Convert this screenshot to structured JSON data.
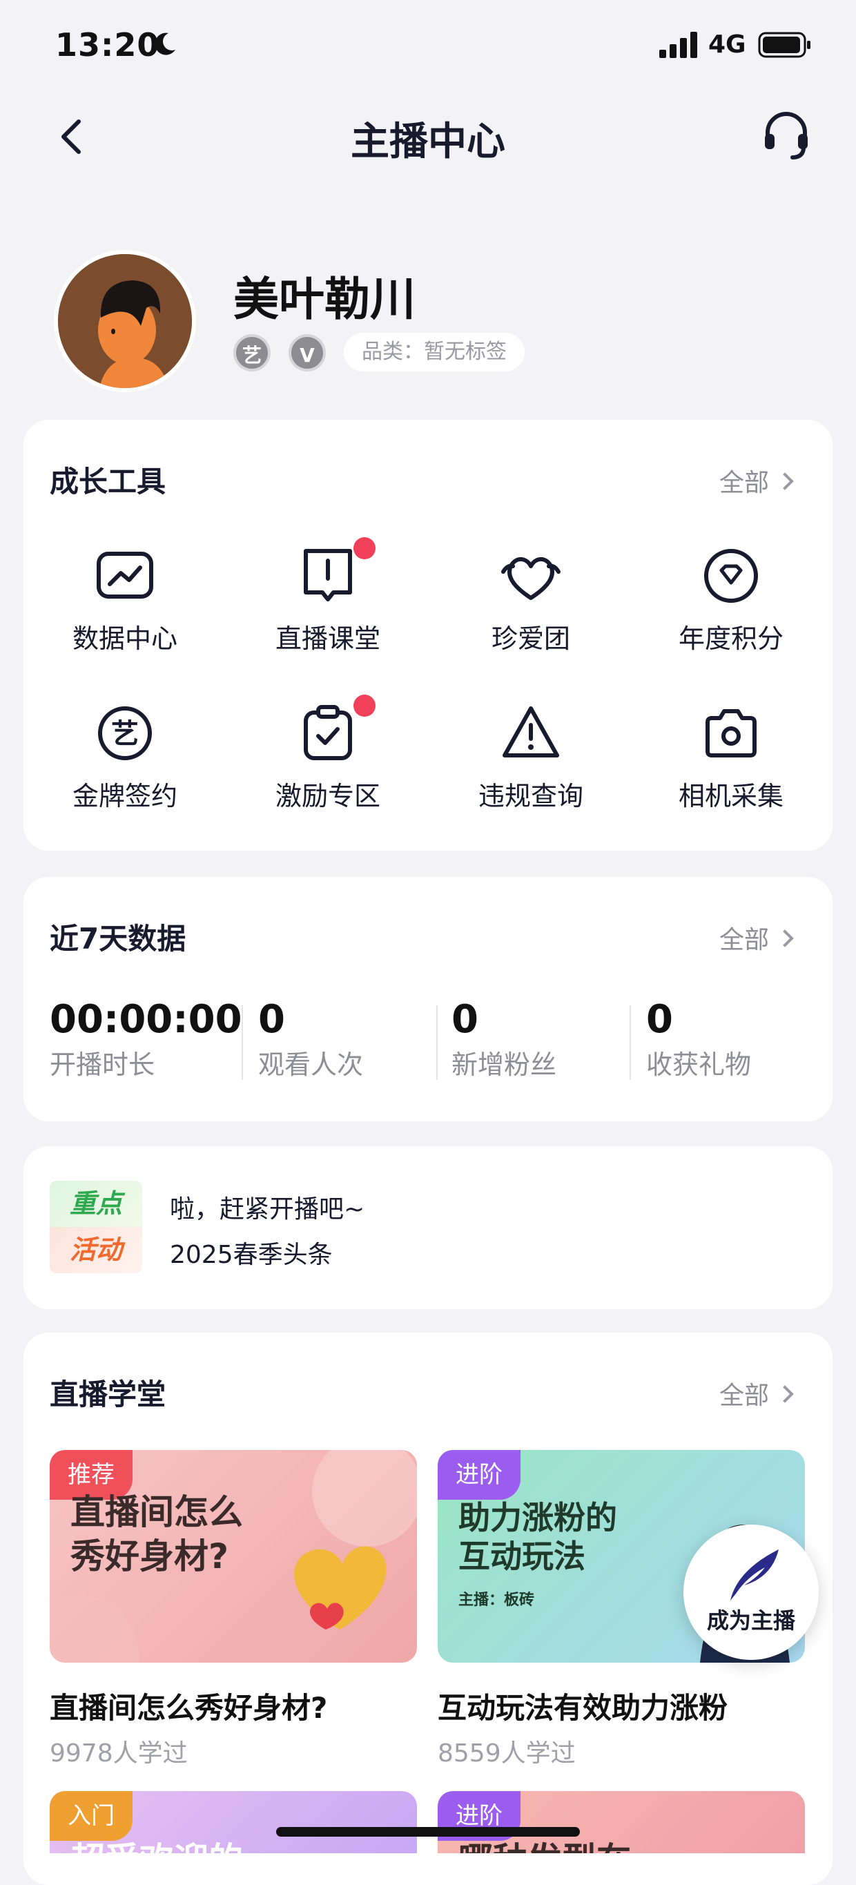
{
  "status": {
    "time": "13:20",
    "network": "4G"
  },
  "nav": {
    "title": "主播中心"
  },
  "profile": {
    "name": "美叶勒川",
    "badge_yi": "艺",
    "badge_v": "V",
    "category": "品类：暂无标签"
  },
  "growth": {
    "title": "成长工具",
    "more": "全部",
    "tools": [
      {
        "label": "数据中心",
        "icon": "chart-icon",
        "dot": false
      },
      {
        "label": "直播课堂",
        "icon": "book-icon",
        "dot": true
      },
      {
        "label": "珍爱团",
        "icon": "heart-icon",
        "dot": false
      },
      {
        "label": "年度积分",
        "icon": "diamond-icon",
        "dot": false
      },
      {
        "label": "金牌签约",
        "icon": "yi-circle-icon",
        "dot": false
      },
      {
        "label": "激励专区",
        "icon": "clipboard-check-icon",
        "dot": true
      },
      {
        "label": "违规查询",
        "icon": "warning-icon",
        "dot": false
      },
      {
        "label": "相机采集",
        "icon": "camera-icon",
        "dot": false
      }
    ]
  },
  "weekly": {
    "title": "近7天数据",
    "more": "全部",
    "stats": [
      {
        "value": "00:00:00",
        "label": "开播时长"
      },
      {
        "value": "0",
        "label": "观看人次"
      },
      {
        "value": "0",
        "label": "新增粉丝"
      },
      {
        "value": "0",
        "label": "收获礼物"
      }
    ]
  },
  "promo": {
    "badge_top": "重点",
    "badge_bottom": "活动",
    "lines": [
      "啦，赶紧开播吧~",
      "2025春季头条"
    ]
  },
  "school": {
    "title": "直播学堂",
    "more": "全部",
    "courses": [
      {
        "tag": "推荐",
        "tag_color": "#F0505A",
        "thumb_text": [
          "直播间怎么",
          "秀好身材?"
        ],
        "title": "直播间怎么秀好身材?",
        "learners": "9978人学过"
      },
      {
        "tag": "进阶",
        "tag_color": "#9B5CF0",
        "thumb_text": [
          "助力涨粉的",
          "互动玩法"
        ],
        "thumb_sub": "主播：板砖",
        "title": "互动玩法有效助力涨粉",
        "learners": "8559人学过"
      },
      {
        "tag": "入门",
        "tag_color": "#F0A030",
        "thumb_text": [
          "超受欢迎的"
        ]
      },
      {
        "tag": "进阶",
        "tag_color": "#9B5CF0",
        "thumb_text": [
          "哪种发型在"
        ]
      }
    ]
  },
  "fab": {
    "label": "成为主播"
  },
  "colors": {
    "accent_red": "#F0405A",
    "background": "#F3F3F6",
    "text_primary": "#1A1A2E"
  }
}
